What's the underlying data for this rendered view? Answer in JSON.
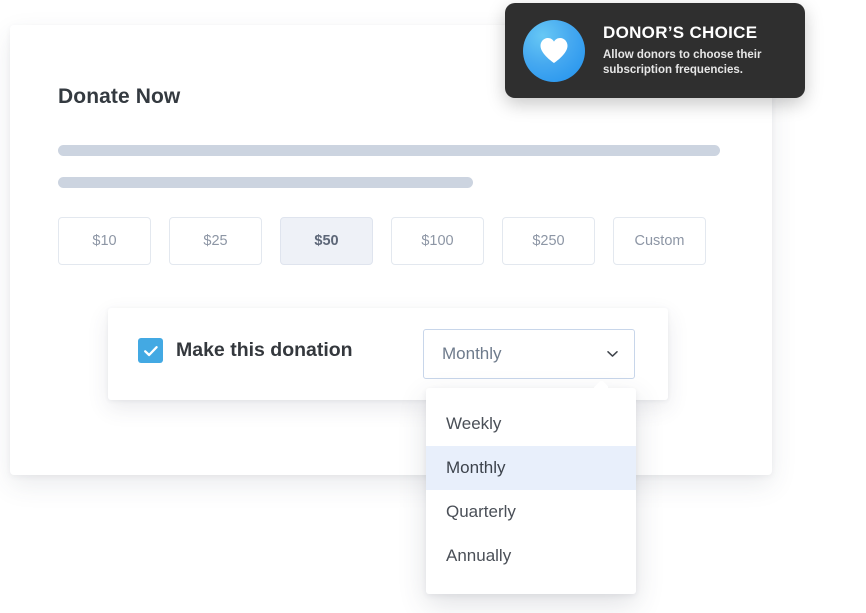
{
  "card": {
    "title": "Donate Now",
    "skeleton_lines": 2
  },
  "amounts": {
    "options": [
      {
        "label": "$10",
        "selected": false
      },
      {
        "label": "$25",
        "selected": false
      },
      {
        "label": "$50",
        "selected": true
      },
      {
        "label": "$100",
        "selected": false
      },
      {
        "label": "$250",
        "selected": false
      },
      {
        "label": "Custom",
        "selected": false
      }
    ]
  },
  "recurring": {
    "checkbox_checked": true,
    "label": "Make this donation",
    "frequency_value": "Monthly",
    "frequency_options": [
      {
        "label": "Weekly",
        "active": false
      },
      {
        "label": "Monthly",
        "active": true
      },
      {
        "label": "Quarterly",
        "active": false
      },
      {
        "label": "Annually",
        "active": false
      }
    ]
  },
  "tooltip": {
    "icon": "heart-icon",
    "title": "DONOR’S CHOICE",
    "description": "Allow donors to choose their subscription frequencies."
  },
  "colors": {
    "accent_blue": "#43a9e3",
    "selected_amount_bg": "#eef1f7",
    "dropdown_active_bg": "#e8effb",
    "tooltip_bg": "#2f2f2f",
    "skeleton_gray": "#ccd4e0"
  }
}
